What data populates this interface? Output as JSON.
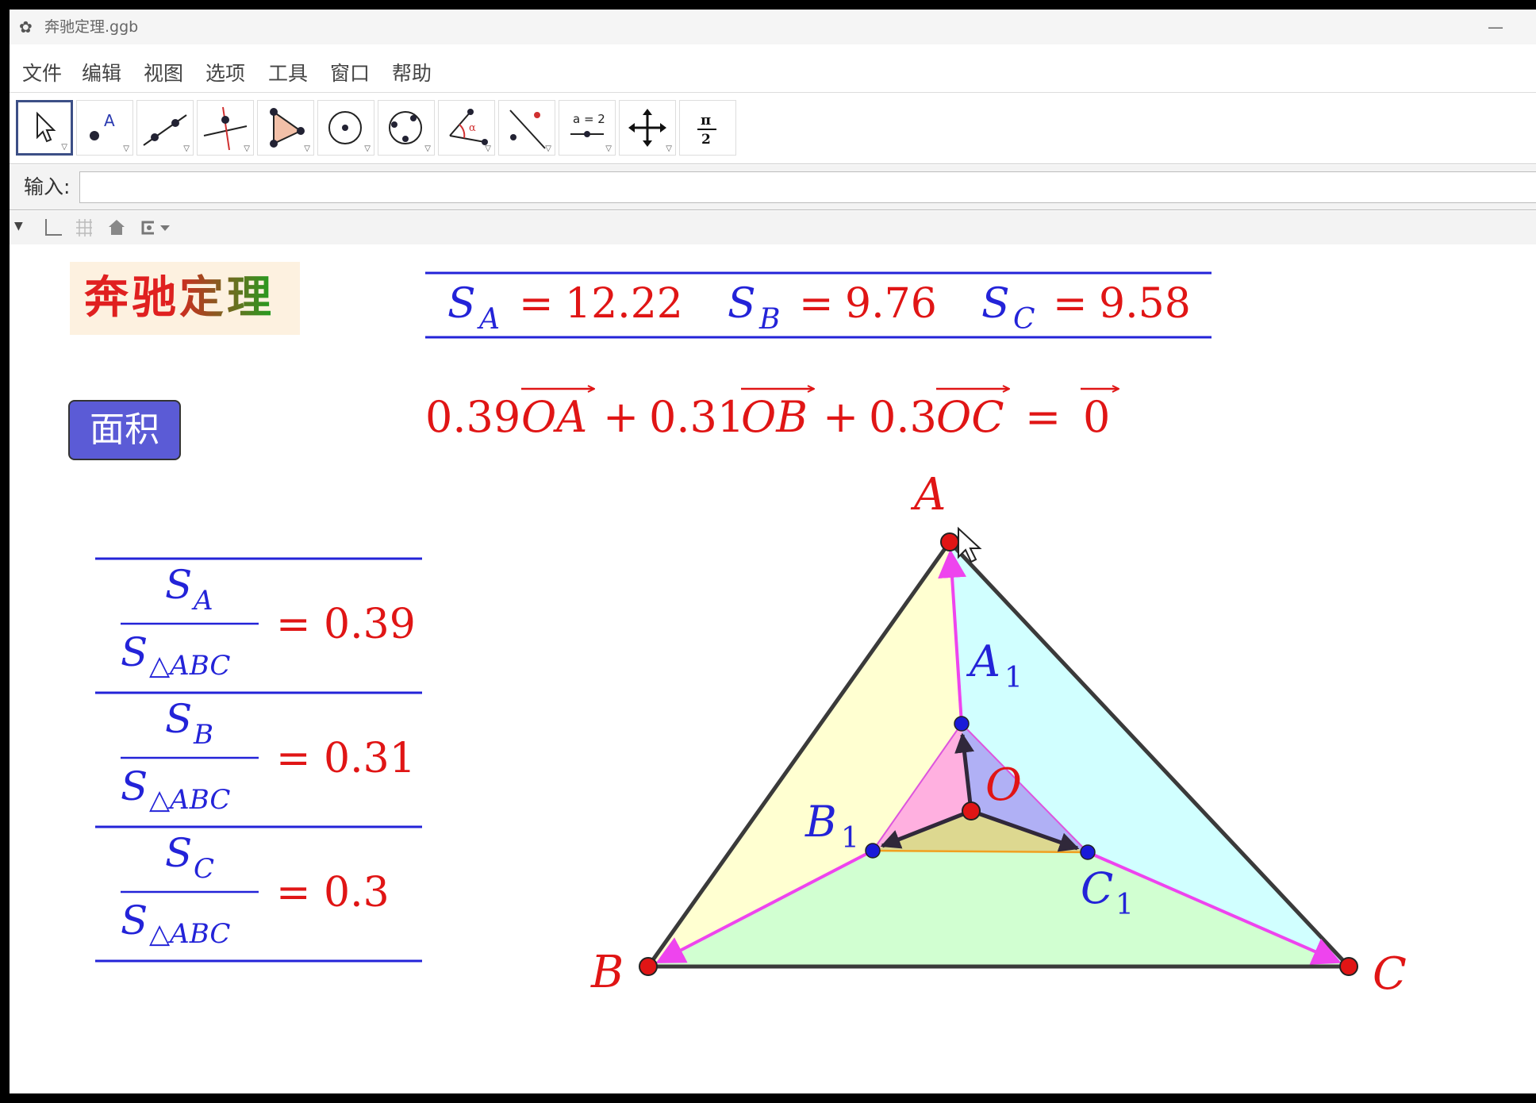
{
  "window": {
    "title": "奔驰定理.ggb"
  },
  "menu": [
    "文件",
    "编辑",
    "视图",
    "选项",
    "工具",
    "窗口",
    "帮助"
  ],
  "toolbar": {
    "tools": [
      "move-tool-icon",
      "point-tool-icon",
      "line-tool-icon",
      "perpendicular-tool-icon",
      "polygon-tool-icon",
      "circle-tool-icon",
      "conic-tool-icon",
      "angle-tool-icon",
      "reflect-tool-icon",
      "slider-tool-icon",
      "move-view-tool-icon",
      "pi-over-2-tool-icon"
    ],
    "slider_label": "a = 2"
  },
  "input": {
    "label": "输入:",
    "value": ""
  },
  "canvas": {
    "title": "奔驰定理",
    "area_button": "面积",
    "areas": {
      "sa": {
        "name": "S",
        "sub": "A",
        "value": "12.22"
      },
      "sb": {
        "name": "S",
        "sub": "B",
        "value": "9.76"
      },
      "sc": {
        "name": "S",
        "sub": "C",
        "value": "9.58"
      }
    },
    "vector_eq": {
      "c1": "0.39",
      "v1": "OA",
      "c2": "0.31",
      "v2": "OB",
      "c3": "0.3",
      "v3": "OC",
      "zero": "0"
    },
    "ratios": [
      {
        "num_sub": "A",
        "den_sub": "△ABC",
        "value": "0.39"
      },
      {
        "num_sub": "B",
        "den_sub": "△ABC",
        "value": "0.31"
      },
      {
        "num_sub": "C",
        "den_sub": "△ABC",
        "value": "0.3"
      }
    ],
    "labels": {
      "A": "A",
      "B": "B",
      "C": "C",
      "O": "O",
      "A1": "A",
      "B1": "B",
      "C1": "C",
      "one": "1"
    }
  },
  "colors": {
    "red": "#e01515",
    "blue": "#2323d8",
    "magenta": "#ee44ee",
    "region_yellow": "#ffffcc",
    "region_cyan": "#ccffff",
    "region_green": "#ccffcc"
  }
}
